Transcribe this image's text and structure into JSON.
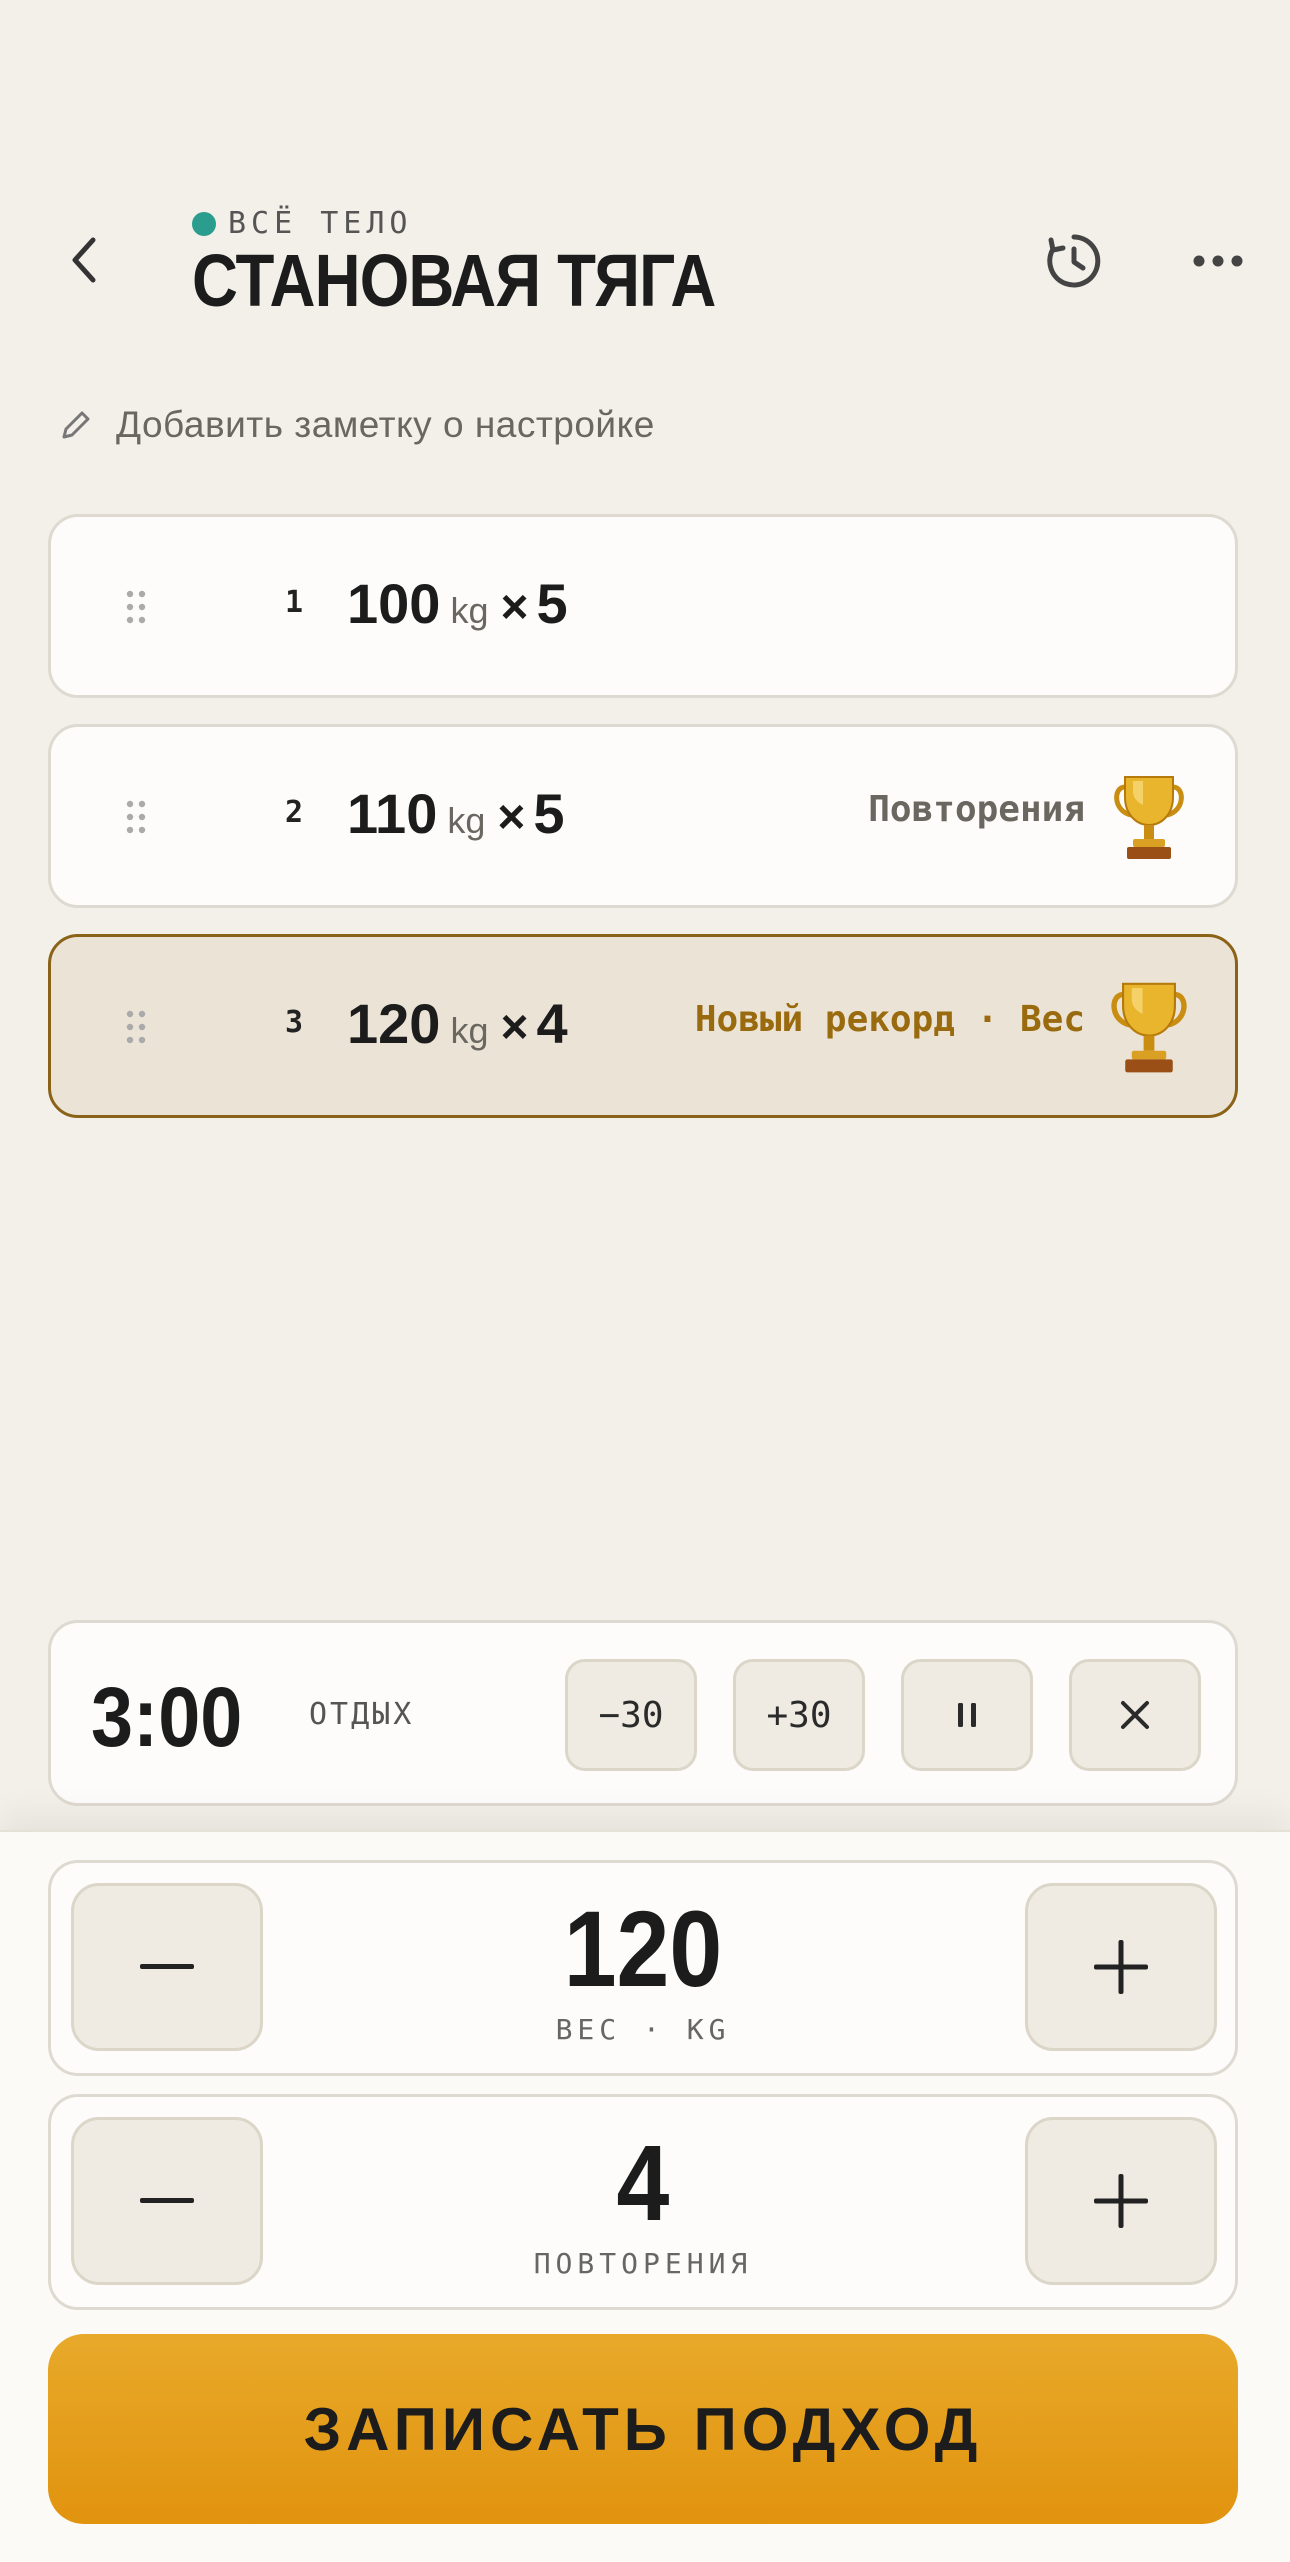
{
  "header": {
    "category": "ВСЁ ТЕЛО",
    "title": "СТАНОВАЯ ТЯГА",
    "category_color": "#2a9d8f"
  },
  "note": {
    "label": "Добавить заметку о настройке"
  },
  "sets": [
    {
      "number": "1",
      "weight": "100",
      "unit": "kg",
      "times": "×",
      "reps": "5",
      "badge": "",
      "trophy": false,
      "active": false
    },
    {
      "number": "2",
      "weight": "110",
      "unit": "kg",
      "times": "×",
      "reps": "5",
      "badge": "Повторения",
      "trophy": true,
      "active": false
    },
    {
      "number": "3",
      "weight": "120",
      "unit": "kg",
      "times": "×",
      "reps": "4",
      "badge": "Новый рекорд · Вес",
      "trophy": true,
      "active": true
    }
  ],
  "timer": {
    "time": "3:00",
    "label": "ОТДЫХ",
    "minus_label": "−30",
    "plus_label": "+30"
  },
  "weight_stepper": {
    "value": "120",
    "label": "ВЕС · KG"
  },
  "reps_stepper": {
    "value": "4",
    "label": "ПОВТОРЕНИЯ"
  },
  "log_button": {
    "label": "ЗАПИСАТЬ ПОДХОД"
  },
  "colors": {
    "accent": "#e39c1a",
    "record": "#9a6a0e",
    "active_border": "#8a6318"
  }
}
